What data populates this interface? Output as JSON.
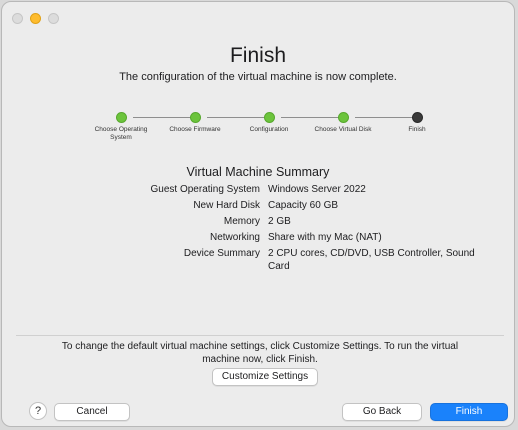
{
  "header": {
    "title": "Finish",
    "subtitle": "The configuration of the virtual machine is now complete."
  },
  "steps": [
    {
      "label": "Choose Operating System",
      "status": "completed"
    },
    {
      "label": "Choose Firmware",
      "status": "completed"
    },
    {
      "label": "Configuration",
      "status": "completed"
    },
    {
      "label": "Choose Virtual Disk",
      "status": "completed"
    },
    {
      "label": "Finish",
      "status": "current"
    }
  ],
  "summary": {
    "title": "Virtual Machine Summary",
    "rows": [
      {
        "key": "Guest Operating System",
        "value": "Windows Server 2022"
      },
      {
        "key": "New Hard Disk",
        "value": "Capacity 60 GB"
      },
      {
        "key": "Memory",
        "value": "2 GB"
      },
      {
        "key": "Networking",
        "value": "Share with my Mac (NAT)"
      },
      {
        "key": "Device Summary",
        "value": "2 CPU cores, CD/DVD, USB Controller, Sound Card"
      }
    ]
  },
  "info_text": "To change the default virtual machine settings, click Customize Settings. To run the virtual machine now, click Finish.",
  "buttons": {
    "customize": "Customize Settings",
    "help": "?",
    "cancel": "Cancel",
    "go_back": "Go Back",
    "finish": "Finish"
  },
  "colors": {
    "completed_step": "#6cc43c",
    "current_step": "#3a3a3a",
    "primary_button": "#1a82fb"
  }
}
